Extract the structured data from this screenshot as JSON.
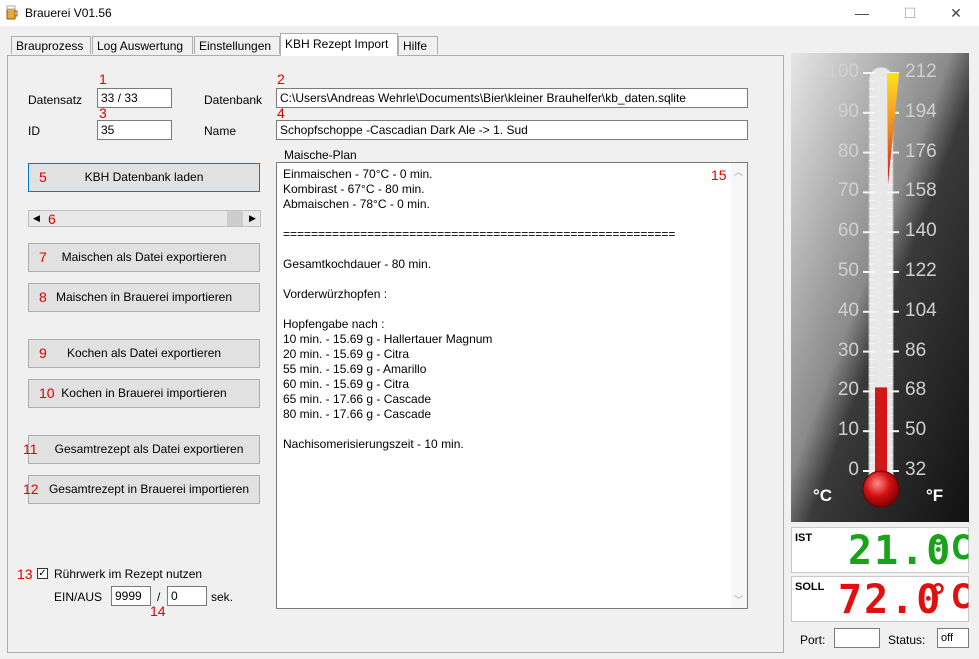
{
  "window": {
    "title": "Brauerei V01.56",
    "minimize": "—",
    "maximize": "☐",
    "close": "✕"
  },
  "tabs": [
    "Brauprozess",
    "Log Auswertung",
    "Einstellungen",
    "KBH Rezept Import",
    "Hilfe"
  ],
  "active_tab": "KBH Rezept Import",
  "form": {
    "datensatz_label": "Datensatz",
    "datensatz_value": "33 / 33",
    "id_label": "ID",
    "id_value": "35",
    "datenbank_label": "Datenbank",
    "datenbank_value": "C:\\Users\\Andreas Wehrle\\Documents\\Bier\\kleiner Brauhelfer\\kb_daten.sqlite",
    "name_label": "Name",
    "name_value": "Schopfschoppe -Cascadian Dark Ale -> 1. Sud",
    "maische_label": "Maische-Plan"
  },
  "markers": {
    "m1": "1",
    "m2": "2",
    "m3": "3",
    "m4": "4",
    "m5": "5",
    "m6": "6",
    "m7": "7",
    "m8": "8",
    "m9": "9",
    "m10": "10",
    "m11": "11",
    "m12": "12",
    "m13": "13",
    "m14": "14",
    "m15": "15"
  },
  "buttons": {
    "load_db": "KBH Datenbank laden",
    "maischen_export": "Maischen als Datei exportieren",
    "maischen_import": "Maischen in Brauerei importieren",
    "kochen_export": "Kochen als Datei exportieren",
    "kochen_import": "Kochen in Brauerei importieren",
    "gesamt_export": "Gesamtrezept als Datei exportieren",
    "gesamt_import": "Gesamtrezept in Brauerei importieren"
  },
  "mash_plan": [
    "Einmaischen - 70°C - 0 min.",
    "Kombirast - 67°C - 80 min.",
    "Abmaischen - 78°C - 0 min.",
    "",
    "========================================================",
    "",
    "Gesamtkochdauer - 80 min.",
    "",
    "Vorderwürzhopfen :",
    "",
    "Hopfengabe nach :",
    "10 min. - 15.69 g - Hallertauer Magnum",
    "20 min. - 15.69 g - Citra",
    "55 min. - 15.69 g - Amarillo",
    "60 min. - 15.69 g - Citra",
    "65 min. - 17.66 g - Cascade",
    "80 min. - 17.66 g - Cascade",
    "",
    "Nachisomerisierungszeit - 10 min."
  ],
  "stirrer": {
    "checkbox_label": "Rührwerk im Rezept nutzen",
    "checked": true,
    "einaus_label": "EIN/AUS",
    "ein_value": "9999",
    "separator": "/",
    "aus_value": "0",
    "unit": "sek."
  },
  "thermometer": {
    "celsius_ticks": [
      "100",
      "90",
      "80",
      "70",
      "60",
      "50",
      "40",
      "30",
      "20",
      "10",
      "0"
    ],
    "fahrenheit_ticks": [
      "212",
      "194",
      "176",
      "158",
      "140",
      "122",
      "104",
      "86",
      "68",
      "50",
      "32"
    ],
    "celsius_unit": "°C",
    "fahrenheit_unit": "°F",
    "current_value_c": 21.0,
    "target_value_c": 72.0
  },
  "ist": {
    "label": "IST",
    "value": "21.0",
    "unit": "°C",
    "color": "#1aa31a"
  },
  "soll": {
    "label": "SOLL",
    "value": "72.0",
    "unit": "°C",
    "color": "#e01010"
  },
  "status_bar": {
    "port_label": "Port:",
    "port_value": "",
    "status_label": "Status:",
    "status_value": "off"
  }
}
